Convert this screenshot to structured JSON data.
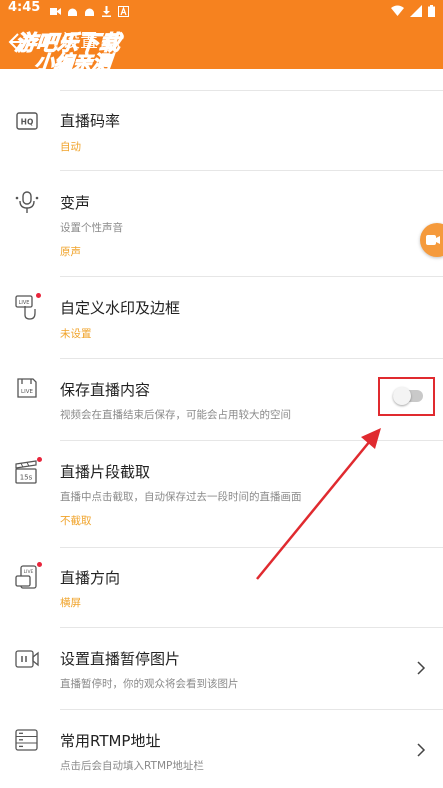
{
  "status_bar": {
    "time": "4:45"
  },
  "header": {
    "title": "设置",
    "watermark_line1": "游吧乐下载",
    "watermark_line2": "小编亲测"
  },
  "settings": {
    "items": [
      {
        "icon": "hq-icon",
        "title": "直播码率",
        "value": "自动"
      },
      {
        "icon": "microphone-icon",
        "title": "变声",
        "desc": "设置个性声音",
        "value": "原声"
      },
      {
        "icon": "watermark-frame-icon",
        "title": "自定义水印及边框",
        "value": "未设置",
        "has_dot": true
      },
      {
        "icon": "save-live-icon",
        "title": "保存直播内容",
        "desc": "视频会在直播结束后保存，可能会占用较大的空间",
        "toggle": "off"
      },
      {
        "icon": "clip-15s-icon",
        "title": "直播片段截取",
        "desc": "直播中点击截取，自动保存过去一段时间的直播画面",
        "value": "不截取",
        "has_dot": true
      },
      {
        "icon": "orientation-icon",
        "title": "直播方向",
        "value": "横屏",
        "has_dot": true
      },
      {
        "icon": "pause-image-icon",
        "title": "设置直播暂停图片",
        "desc": "直播暂停时，你的观众将会看到该图片",
        "chevron": true
      },
      {
        "icon": "rtmp-icon",
        "title": "常用RTMP地址",
        "desc": "点击后会自动填入RTMP地址栏",
        "chevron": true
      }
    ]
  },
  "colors": {
    "brand_orange": "#f6821f",
    "value_orange": "#f0a32a",
    "highlight_red": "#e02a2f",
    "notification_dot": "#e8253c"
  }
}
